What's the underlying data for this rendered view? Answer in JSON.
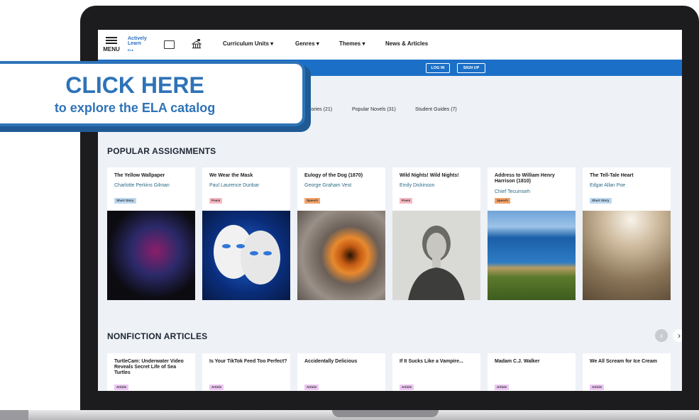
{
  "nav": {
    "menu_label": "MENU",
    "logo_line1": "Actively",
    "logo_line2": "Learn",
    "logo_line3": "ELA",
    "items": [
      "Curriculum Units ▾",
      "Genres ▾",
      "Themes ▾",
      "News & Articles"
    ]
  },
  "auth": {
    "login": "LOG IN",
    "signup": "SIGN UP"
  },
  "categories": [
    "t Stories (21)",
    "Popular Novels (31)",
    "Student Guides (7)"
  ],
  "popular": {
    "title": "POPULAR ASSIGNMENTS",
    "cards": [
      {
        "title": "The Yellow Wallpaper",
        "author": "Charlotte Perkins Gilman",
        "badge": "Short Story",
        "badge_color": "#bcd8f2",
        "image": "swirling-face"
      },
      {
        "title": "We Wear the Mask",
        "author": "Paul Laurence Dunbar",
        "badge": "Poem",
        "badge_color": "#f7b8c2",
        "image": "masks"
      },
      {
        "title": "Eulogy of the Dog (1870)",
        "author": "George Graham Vest",
        "badge": "Speech",
        "badge_color": "#f4a36a",
        "image": "dog-eye"
      },
      {
        "title": "Wild Nights! Wild Nights!",
        "author": "Emily Dickinson",
        "badge": "Poem",
        "badge_color": "#f7b8c2",
        "image": "portrait"
      },
      {
        "title": "Address to William Henry Harrison (1810)",
        "author": "Chief Tecumseh",
        "badge": "Speech",
        "badge_color": "#f4a36a",
        "image": "coastline"
      },
      {
        "title": "The Tell-Tale Heart",
        "author": "Edgar Allan Poe",
        "badge": "Short Story",
        "badge_color": "#bcd8f2",
        "image": "floorboards"
      }
    ]
  },
  "nonfiction": {
    "title": "NONFICTION ARTICLES",
    "cards": [
      {
        "title": "TurtleCam: Underwater Video Reveals Secret Life of Sea Turtles",
        "badge": "Article"
      },
      {
        "title": "Is Your TikTok Feed Too Perfect?",
        "badge": "Article"
      },
      {
        "title": "Accidentally Delicious",
        "badge": "Article"
      },
      {
        "title": "If It Sucks Like a Vampire...",
        "badge": "Article"
      },
      {
        "title": "Madam C.J. Walker",
        "badge": "Article"
      },
      {
        "title": "We All Scream for Ice Cream",
        "badge": "Article"
      }
    ],
    "badge_color": "#ecc7f2"
  },
  "callout": {
    "title": "CLICK HERE",
    "subtitle": "to explore the ELA catalog"
  },
  "colors": {
    "brand_blue": "#1b6fc7",
    "callout_blue": "#2e73b8"
  }
}
